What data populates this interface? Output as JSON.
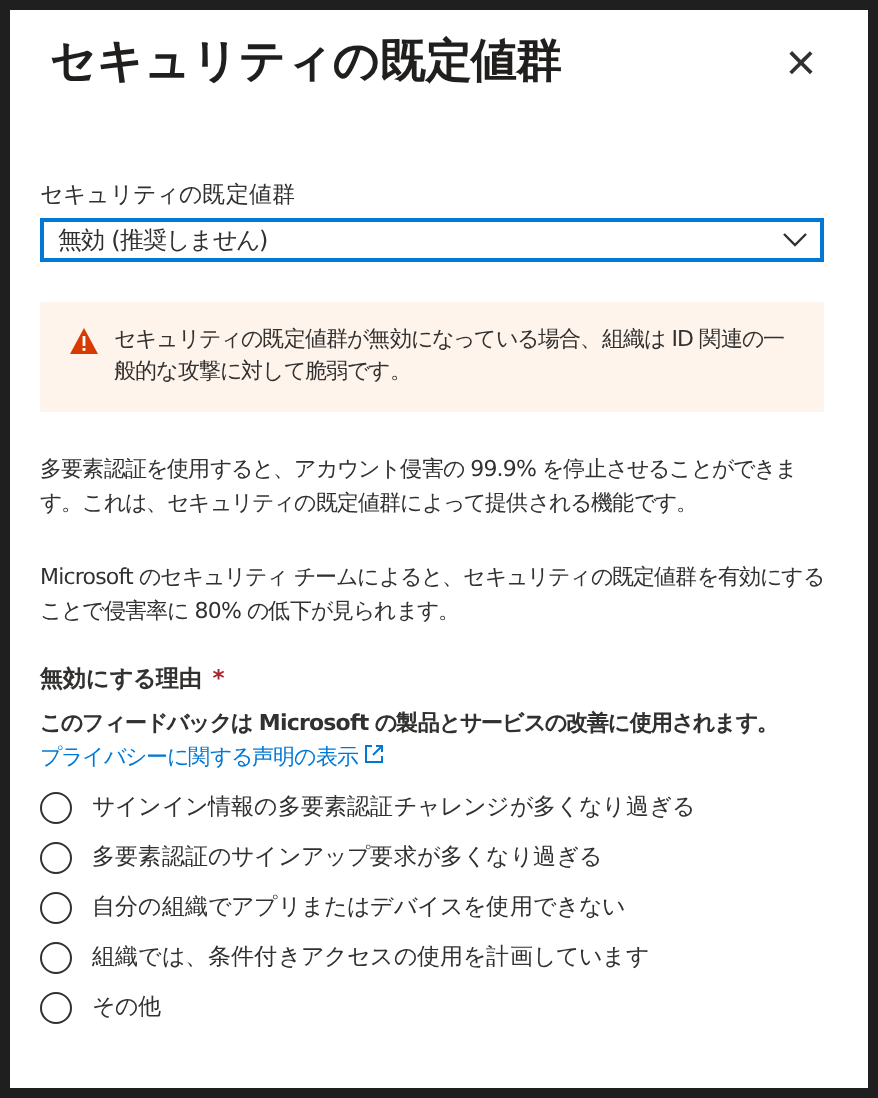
{
  "panel": {
    "title": "セキュリティの既定値群",
    "close": "×"
  },
  "dropdown": {
    "label": "セキュリティの既定値群",
    "value": "無効 (推奨しません)",
    "focused": true
  },
  "warning": {
    "text": "セキュリティの既定値群が無効になっている場合、組織は ID 関連の一般的な攻撃に対して脆弱です。"
  },
  "paragraphs": [
    "多要素認証を使用すると、アカウント侵害の 99.9% を停止させることができます。これは、セキュリティの既定値群によって提供される機能です。",
    "Microsoft のセキュリティ チームによると、セキュリティの既定値群を有効にすることで侵害率に 80% の低下が見られます。"
  ],
  "reason": {
    "label": "無効にする理由",
    "required_mark": "*",
    "note": "このフィードバックは Microsoft の製品とサービスの改善に使用されます。",
    "link": "プライバシーに関する声明の表示",
    "options": [
      {
        "label": "サインイン情報の多要素認証チャレンジが多くなり過ぎる",
        "selected": false
      },
      {
        "label": "多要素認証のサインアップ要求が多くなり過ぎる",
        "selected": false
      },
      {
        "label": "自分の組織でアプリまたはデバイスを使用できない",
        "selected": false
      },
      {
        "label": "組織では、条件付きアクセスの使用を計画しています",
        "selected": false
      },
      {
        "label": "その他",
        "selected": false
      }
    ]
  }
}
